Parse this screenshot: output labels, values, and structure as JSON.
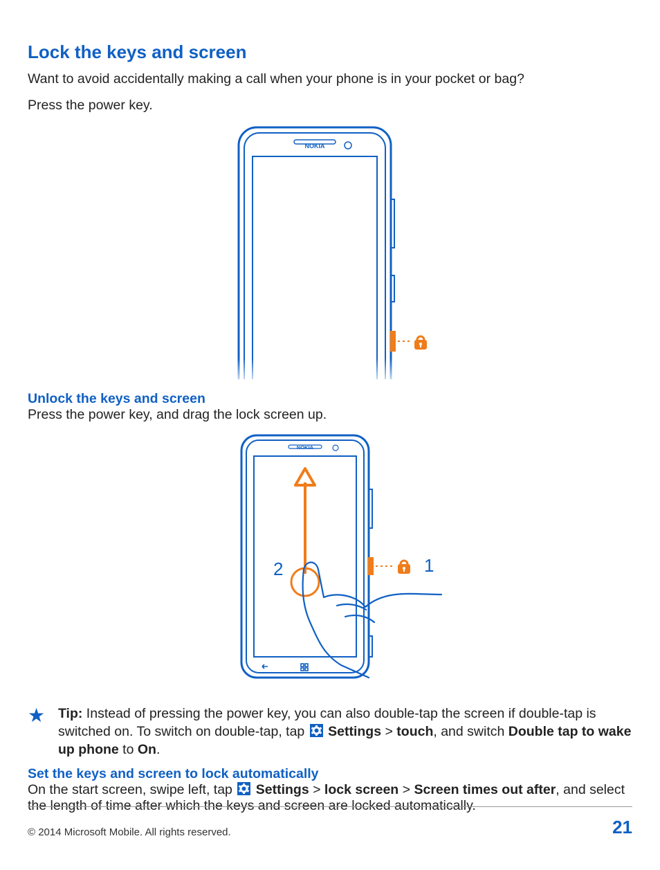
{
  "title": "Lock the keys and screen",
  "intro_1": "Want to avoid accidentally making a call when your phone is in your pocket or bag?",
  "intro_2": "Press the power key.",
  "fig1": {
    "brand": "NOKIA"
  },
  "unlock": {
    "heading": "Unlock the keys and screen",
    "body": "Press the power key, and drag the lock screen up."
  },
  "fig2": {
    "brand": "NOKIA",
    "label1": "1",
    "label2": "2"
  },
  "tip": {
    "label": "Tip:",
    "t1": " Instead of pressing the power key, you can also double-tap the screen if double-tap is switched on. To switch on double-tap, tap ",
    "settings": "Settings",
    "gt1": " > ",
    "touch": "touch",
    "t2": ", and switch ",
    "dtw": "Double tap to wake up phone",
    "to": " to ",
    "on": "On",
    "dot": "."
  },
  "auto": {
    "heading": "Set the keys and screen to lock automatically",
    "t1": "On the start screen, swipe left, tap ",
    "settings": "Settings",
    "gt1": " > ",
    "lockscreen": "lock screen",
    "gt2": " > ",
    "timeout": "Screen times out after",
    "t2": ", and select the length of time after which the keys and screen are locked automatically."
  },
  "footer": {
    "copyright": "© 2014 Microsoft Mobile. All rights reserved.",
    "page": "21"
  }
}
